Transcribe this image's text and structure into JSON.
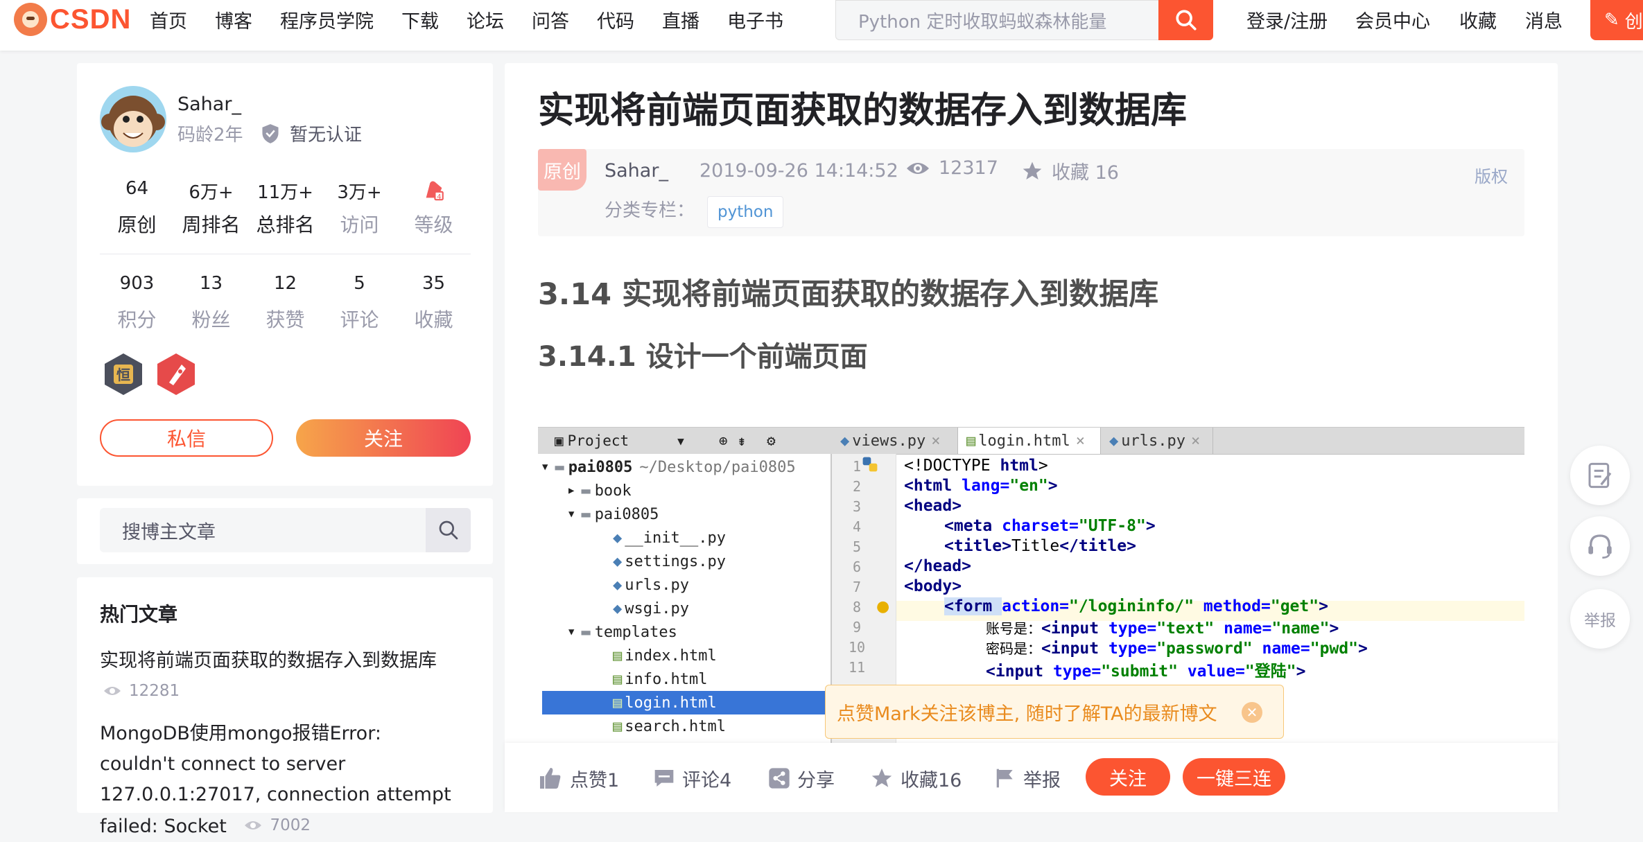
{
  "header": {
    "logo": "CSDN",
    "nav": [
      "首页",
      "博客",
      "程序员学院",
      "下载",
      "论坛",
      "问答",
      "代码",
      "直播",
      "电子书"
    ],
    "search_placeholder": "Python 定时收取蚂蚁森林能量",
    "right_links": [
      "登录/注册",
      "会员中心",
      "收藏",
      "消息"
    ],
    "create_label": "创"
  },
  "profile": {
    "name": "Sahar_",
    "code_age": "码龄2年",
    "cert": "暂无认证",
    "stats_row1": [
      {
        "value": "64",
        "label": "原创"
      },
      {
        "value": "6万+",
        "label": "周排名"
      },
      {
        "value": "11万+",
        "label": "总排名"
      },
      {
        "value": "3万+",
        "label": "访问"
      },
      {
        "value": "",
        "label": "等级"
      }
    ],
    "stats_row2": [
      {
        "value": "903",
        "label": "积分"
      },
      {
        "value": "13",
        "label": "粉丝"
      },
      {
        "value": "12",
        "label": "获赞"
      },
      {
        "value": "5",
        "label": "评论"
      },
      {
        "value": "35",
        "label": "收藏"
      }
    ],
    "badge1_glyph": "恒",
    "message_label": "私信",
    "follow_label": "关注"
  },
  "blogger_search": {
    "placeholder": "搜博主文章"
  },
  "hot": {
    "title": "热门文章",
    "items": [
      {
        "title": "实现将前端页面获取的数据存入到数据库",
        "views": "12281"
      },
      {
        "title": "MongoDB使用mongo报错Error: couldn't connect to server 127.0.0.1:27017, connection attempt failed: Socket",
        "views": "7002"
      }
    ]
  },
  "article": {
    "title": "实现将前端页面获取的数据存入到数据库",
    "original": "原创",
    "author": "Sahar_",
    "date": "2019-09-26 14:14:52",
    "reads": "12317",
    "fav": "收藏 16",
    "copyright": "版权",
    "category_label": "分类专栏：",
    "category_tag": "python",
    "h2": "3.14 实现将前端页面获取的数据存入到数据库",
    "h3": "3.14.1 设计一个前端页面"
  },
  "ide": {
    "project_label": "Project",
    "tabs": [
      "views.py",
      "login.html",
      "urls.py"
    ],
    "tree": [
      {
        "text": "pai0805",
        "extra": "~/Desktop/pai0805"
      },
      {
        "text": "book"
      },
      {
        "text": "pai0805"
      },
      {
        "text": "__init__.py"
      },
      {
        "text": "settings.py"
      },
      {
        "text": "urls.py"
      },
      {
        "text": "wsgi.py"
      },
      {
        "text": "templates"
      },
      {
        "text": "index.html"
      },
      {
        "text": "info.html"
      },
      {
        "text": "login.html"
      },
      {
        "text": "search.html"
      }
    ],
    "line_numbers": [
      "1",
      "2",
      "3",
      "4",
      "5",
      "6",
      "7",
      "8",
      "9",
      "10",
      "11"
    ],
    "code": {
      "l1a": "<!DOCTYPE ",
      "l1b": "html",
      "l1c": ">",
      "l2a": "<html ",
      "l2b": "lang=",
      "l2c": "\"en\"",
      "l2d": ">",
      "l3": "<head>",
      "l4a": "<meta ",
      "l4b": "charset=",
      "l4c": "\"UTF-8\"",
      "l4d": ">",
      "l5a": "<title>",
      "l5b": "Title",
      "l5c": "</title>",
      "l6": "</head>",
      "l7": "<body>",
      "l8a": "<form ",
      "l8b": "action=",
      "l8c": "\"/logininfo/\" ",
      "l8d": "method=",
      "l8e": "\"get\"",
      "l8f": ">",
      "l9a": "账号是：",
      "l9b": "<input ",
      "l9c": "type=",
      "l9d": "\"text\" ",
      "l9e": "name=",
      "l9f": "\"name\"",
      "l9g": ">",
      "l10a": "密码是：",
      "l10b": "<input ",
      "l10c": "type=",
      "l10d": "\"password\" ",
      "l10e": "name=",
      "l10f": "\"pwd\"",
      "l10g": ">",
      "l11a": "<input ",
      "l11b": "type=",
      "l11c": "\"submit\" ",
      "l11d": "value=",
      "l11e": "\"登陆\"",
      "l11f": ">"
    }
  },
  "tip": "点赞Mark关注该博主, 随时了解TA的最新博文",
  "toolbar": {
    "like": "点赞1",
    "comment": "评论4",
    "share": "分享",
    "fav": "收藏16",
    "report": "举报",
    "follow": "关注",
    "triple": "一键三连"
  },
  "float": {
    "report": "举报"
  },
  "colors": {
    "brand": "#fc5531",
    "link": "#5094d5"
  }
}
